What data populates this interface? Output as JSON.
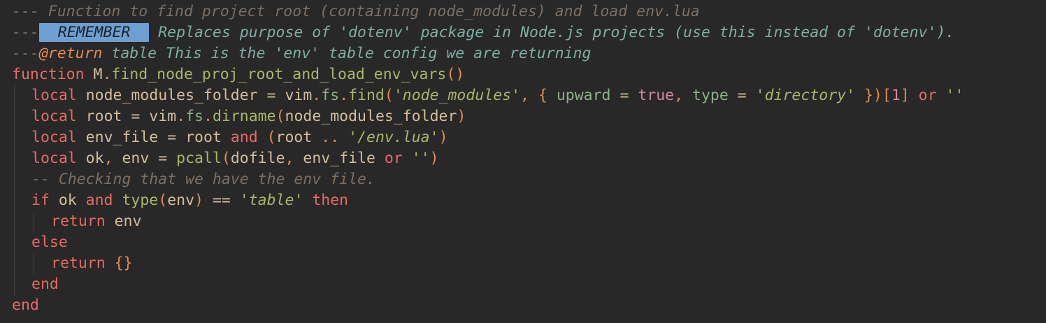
{
  "editor": {
    "lines": [
      {
        "tokens": [
          {
            "t": "--- Function to find project root (containing node_modules) and load env.lua",
            "c": "c-doc"
          }
        ]
      },
      {
        "tokens": [
          {
            "t": "---",
            "c": "c-doc"
          },
          {
            "t": " REMEMBER ",
            "c": "remember"
          },
          {
            "t": " Replaces purpose of 'dotenv' package in Node.js projects (use this instead of 'dotenv').",
            "c": "c-docb"
          }
        ]
      },
      {
        "tokens": [
          {
            "t": "---",
            "c": "c-doc"
          },
          {
            "t": "@return",
            "c": "c-at"
          },
          {
            "t": " table This is the 'env' table config we are returning",
            "c": "c-docb"
          }
        ]
      },
      {
        "tokens": [
          {
            "t": "function",
            "c": "kw"
          },
          {
            "t": " M",
            "c": "id"
          },
          {
            "t": ".",
            "c": "punc"
          },
          {
            "t": "find_node_proj_root_and_load_env_vars",
            "c": "fn"
          },
          {
            "t": "()",
            "c": "br"
          }
        ]
      },
      {
        "indent": 1,
        "tokens": [
          {
            "t": "local",
            "c": "kw"
          },
          {
            "t": " node_modules_folder ",
            "c": "id"
          },
          {
            "t": "=",
            "c": "op"
          },
          {
            "t": " vim",
            "c": "id"
          },
          {
            "t": ".",
            "c": "punc"
          },
          {
            "t": "fs",
            "c": "fld"
          },
          {
            "t": ".",
            "c": "punc"
          },
          {
            "t": "find",
            "c": "fn"
          },
          {
            "t": "(",
            "c": "br"
          },
          {
            "t": "'node_modules'",
            "c": "str2"
          },
          {
            "t": ", ",
            "c": "punc"
          },
          {
            "t": "{ ",
            "c": "br"
          },
          {
            "t": "upward",
            "c": "fld"
          },
          {
            "t": " = ",
            "c": "op"
          },
          {
            "t": "true",
            "c": "bool"
          },
          {
            "t": ", ",
            "c": "punc"
          },
          {
            "t": "type",
            "c": "fld"
          },
          {
            "t": " = ",
            "c": "op"
          },
          {
            "t": "'directory'",
            "c": "str2"
          },
          {
            "t": " })",
            "c": "br"
          },
          {
            "t": "[",
            "c": "br"
          },
          {
            "t": "1",
            "c": "num"
          },
          {
            "t": "]",
            "c": "br"
          },
          {
            "t": " or",
            "c": "kw"
          },
          {
            "t": " ''",
            "c": "str2"
          }
        ]
      },
      {
        "indent": 1,
        "tokens": [
          {
            "t": "local",
            "c": "kw"
          },
          {
            "t": " root ",
            "c": "id"
          },
          {
            "t": "=",
            "c": "op"
          },
          {
            "t": " vim",
            "c": "id"
          },
          {
            "t": ".",
            "c": "punc"
          },
          {
            "t": "fs",
            "c": "fld"
          },
          {
            "t": ".",
            "c": "punc"
          },
          {
            "t": "dirname",
            "c": "fn"
          },
          {
            "t": "(",
            "c": "br"
          },
          {
            "t": "node_modules_folder",
            "c": "id"
          },
          {
            "t": ")",
            "c": "br"
          }
        ]
      },
      {
        "indent": 1,
        "tokens": [
          {
            "t": "local",
            "c": "kw"
          },
          {
            "t": " env_file ",
            "c": "id"
          },
          {
            "t": "=",
            "c": "op"
          },
          {
            "t": " root ",
            "c": "id"
          },
          {
            "t": "and",
            "c": "kw"
          },
          {
            "t": " (",
            "c": "br"
          },
          {
            "t": "root ",
            "c": "id"
          },
          {
            "t": "..",
            "c": "punc"
          },
          {
            "t": " '/env.lua'",
            "c": "str2"
          },
          {
            "t": ")",
            "c": "br"
          }
        ]
      },
      {
        "indent": 1,
        "tokens": [
          {
            "t": "local",
            "c": "kw"
          },
          {
            "t": " ok",
            "c": "id"
          },
          {
            "t": ",",
            "c": "punc"
          },
          {
            "t": " env ",
            "c": "id"
          },
          {
            "t": "=",
            "c": "op"
          },
          {
            "t": " pcall",
            "c": "fn"
          },
          {
            "t": "(",
            "c": "br"
          },
          {
            "t": "dofile",
            "c": "id"
          },
          {
            "t": ",",
            "c": "punc"
          },
          {
            "t": " env_file ",
            "c": "id"
          },
          {
            "t": "or",
            "c": "kw"
          },
          {
            "t": " ''",
            "c": "str2"
          },
          {
            "t": ")",
            "c": "br"
          }
        ]
      },
      {
        "indent": 1,
        "tokens": [
          {
            "t": "-- Checking that we have the env file.",
            "c": "c-com"
          }
        ]
      },
      {
        "indent": 1,
        "tokens": [
          {
            "t": "if",
            "c": "kw"
          },
          {
            "t": " ok ",
            "c": "id"
          },
          {
            "t": "and",
            "c": "kw"
          },
          {
            "t": " type",
            "c": "fn"
          },
          {
            "t": "(",
            "c": "br"
          },
          {
            "t": "env",
            "c": "id"
          },
          {
            "t": ")",
            "c": "br"
          },
          {
            "t": " == ",
            "c": "op"
          },
          {
            "t": "'table'",
            "c": "str2"
          },
          {
            "t": " then",
            "c": "kw"
          }
        ]
      },
      {
        "indent": 2,
        "tokens": [
          {
            "t": "return",
            "c": "kw"
          },
          {
            "t": " env",
            "c": "id"
          }
        ]
      },
      {
        "indent": 1,
        "tokens": [
          {
            "t": "else",
            "c": "kw"
          }
        ]
      },
      {
        "indent": 2,
        "tokens": [
          {
            "t": "return",
            "c": "kw"
          },
          {
            "t": " {}",
            "c": "br"
          }
        ]
      },
      {
        "indent": 1,
        "tokens": [
          {
            "t": "end",
            "c": "kw"
          }
        ]
      },
      {
        "tokens": [
          {
            "t": "end",
            "c": "kw"
          }
        ]
      }
    ]
  }
}
